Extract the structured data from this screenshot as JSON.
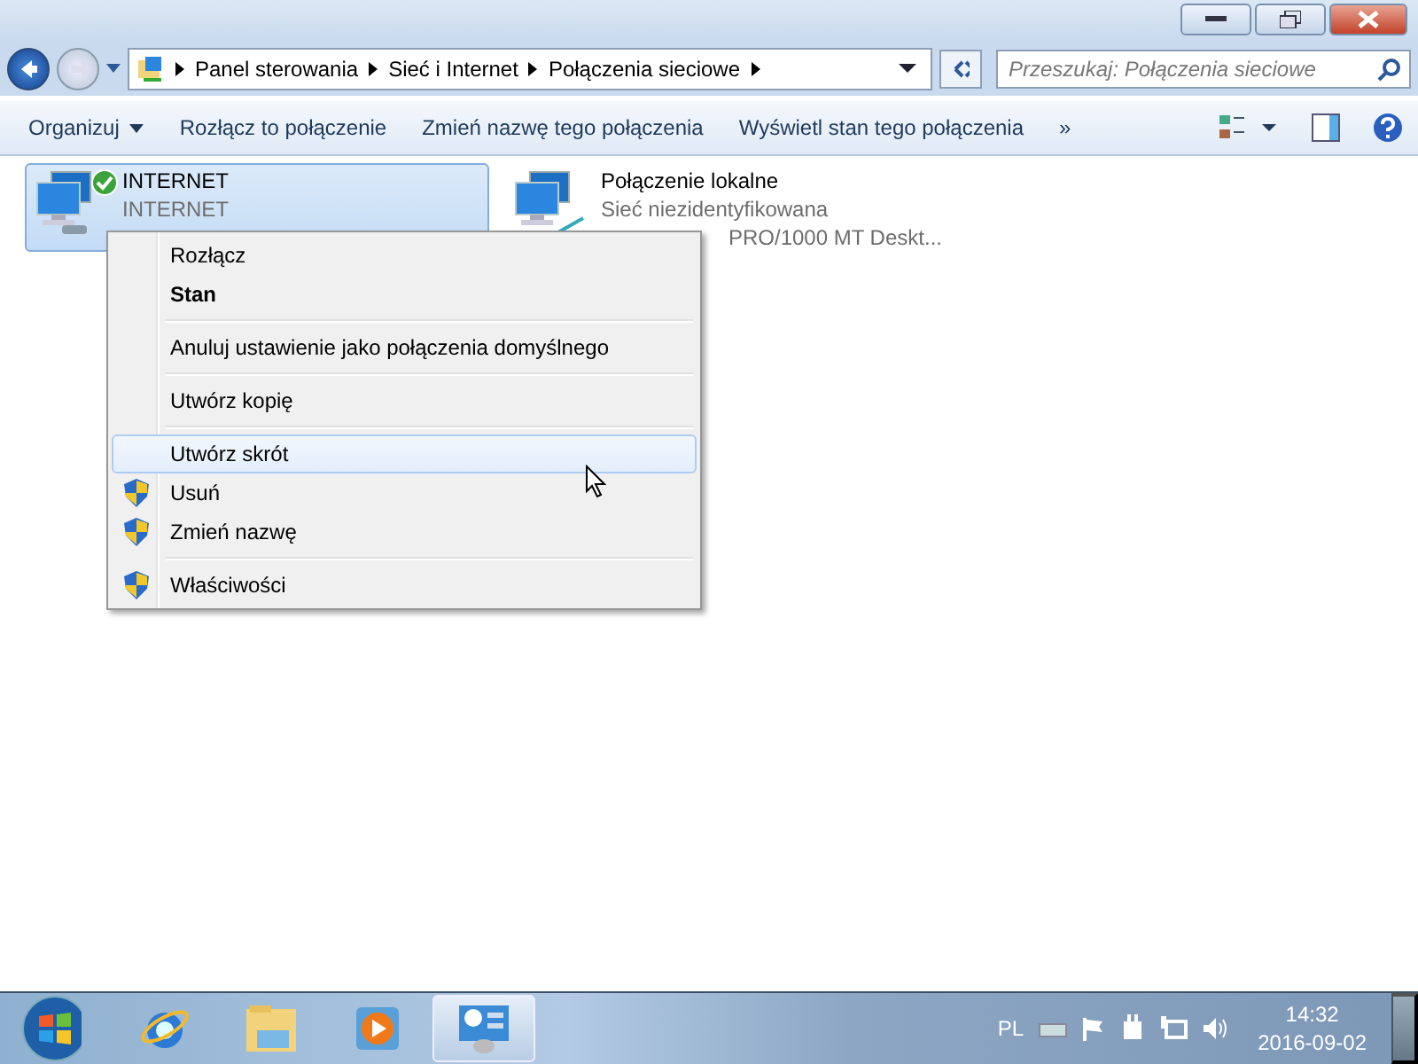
{
  "address_bar": {
    "crumbs": [
      "Panel sterowania",
      "Sieć i Internet",
      "Połączenia sieciowe"
    ]
  },
  "search": {
    "placeholder": "Przeszukaj: Połączenia sieciowe"
  },
  "toolbar": {
    "items": [
      {
        "label": "Organizuj",
        "dropdown": true
      },
      {
        "label": "Rozłącz to połączenie",
        "dropdown": false
      },
      {
        "label": "Zmień nazwę tego połączenia",
        "dropdown": false
      },
      {
        "label": "Wyświetl stan tego połączenia",
        "dropdown": false
      }
    ],
    "more": "»"
  },
  "connections": [
    {
      "name": "INTERNET",
      "status": "INTERNET",
      "selected": true,
      "connected": true
    },
    {
      "name": "Połączenie lokalne",
      "status": "Sieć niezidentyfikowana",
      "device": "PRO/1000 MT Deskt...",
      "selected": false,
      "connected": false
    }
  ],
  "context_menu": {
    "items": [
      {
        "kind": "item",
        "label": "Rozłącz",
        "bold": false,
        "shield": false,
        "selected": false
      },
      {
        "kind": "item",
        "label": "Stan",
        "bold": true,
        "shield": false,
        "selected": false
      },
      {
        "kind": "separator"
      },
      {
        "kind": "item",
        "label": "Anuluj ustawienie jako połączenia domyślnego",
        "bold": false,
        "shield": false,
        "selected": false
      },
      {
        "kind": "separator"
      },
      {
        "kind": "item",
        "label": "Utwórz kopię",
        "bold": false,
        "shield": false,
        "selected": false
      },
      {
        "kind": "separator"
      },
      {
        "kind": "item",
        "label": "Utwórz skrót",
        "bold": false,
        "shield": false,
        "selected": true
      },
      {
        "kind": "item",
        "label": "Usuń",
        "bold": false,
        "shield": true,
        "selected": false
      },
      {
        "kind": "item",
        "label": "Zmień nazwę",
        "bold": false,
        "shield": true,
        "selected": false
      },
      {
        "kind": "separator"
      },
      {
        "kind": "item",
        "label": "Właściwości",
        "bold": false,
        "shield": true,
        "selected": false
      }
    ]
  },
  "taskbar": {
    "apps": [
      {
        "kind": "browser",
        "selected": false
      },
      {
        "kind": "folder",
        "selected": false
      },
      {
        "kind": "media",
        "selected": false
      },
      {
        "kind": "control",
        "selected": true
      }
    ],
    "language": "PL",
    "time": "14:32",
    "date": "2016-09-02"
  }
}
